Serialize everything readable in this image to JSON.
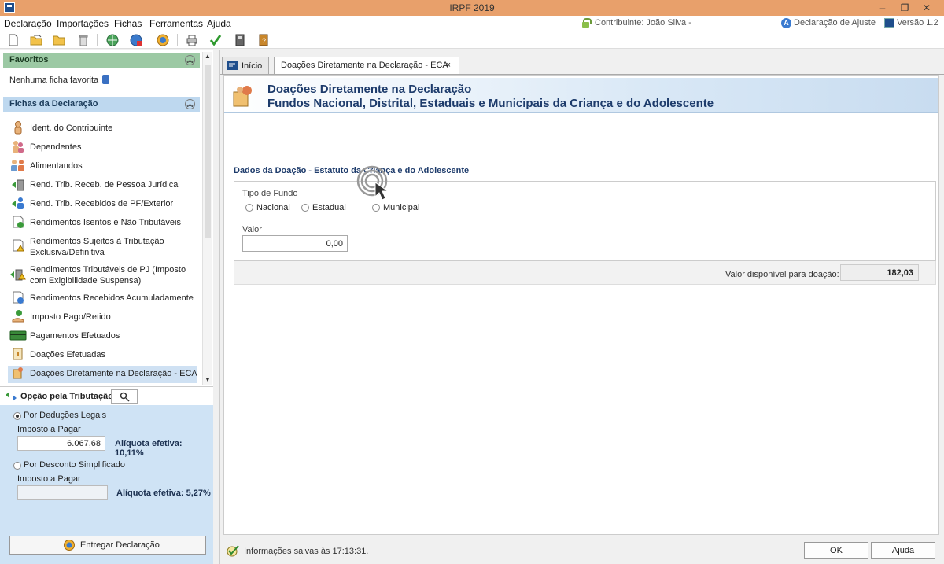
{
  "window": {
    "title": "IRPF 2019",
    "minimize": "–",
    "restore": "❐",
    "close": "✕"
  },
  "menu": {
    "items": [
      "Declaração",
      "Importações",
      "Fichas",
      "Ferramentas",
      "Ajuda"
    ],
    "contribuinte": "Contribuinte: João Silva -",
    "declaracao_tipo": "Declaração de Ajuste",
    "versao": "Versão 1.2"
  },
  "toolbar": {
    "buttons": [
      "new-file-icon",
      "open-folder-icon",
      "folder-icon",
      "trash-icon",
      "globe-receita-icon",
      "globe-transmit-icon",
      "globe-send-icon",
      "print-icon",
      "check-icon",
      "calculator-icon",
      "book-icon"
    ]
  },
  "sidebar": {
    "favoritos_title": "Favoritos",
    "favoritos_empty": "Nenhuma ficha favorita",
    "fichas_title": "Fichas da Declaração",
    "fichas": [
      {
        "label": "Ident. do Contribuinte",
        "icon": "person-icon"
      },
      {
        "label": "Dependentes",
        "icon": "dependents-icon"
      },
      {
        "label": "Alimentandos",
        "icon": "group-icon"
      },
      {
        "label": "Rend. Trib. Receb. de Pessoa Jurídica",
        "icon": "building-arrow-icon"
      },
      {
        "label": "Rend. Trib. Recebidos de PF/Exterior",
        "icon": "person-arrow-icon"
      },
      {
        "label": "Rendimentos Isentos e Não Tributáveis",
        "icon": "doc-check-icon"
      },
      {
        "label": "Rendimentos Sujeitos à Tributação Exclusiva/Definitiva",
        "icon": "doc-warning-icon"
      },
      {
        "label": "Rendimentos Tributáveis de PJ (Imposto com Exigibilidade Suspensa)",
        "icon": "building-warning-icon"
      },
      {
        "label": "Rendimentos Recebidos Acumuladamente",
        "icon": "doc-clock-icon"
      },
      {
        "label": "Imposto Pago/Retido",
        "icon": "money-hand-icon"
      },
      {
        "label": "Pagamentos Efetuados",
        "icon": "card-icon"
      },
      {
        "label": "Doações Efetuadas",
        "icon": "gift-doc-icon"
      },
      {
        "label": "Doações Diretamente na Declaração - ECA",
        "icon": "eca-icon"
      }
    ]
  },
  "tributacao": {
    "label": "Opção pela Tributação:",
    "deducoes_legais": "Por Deduções Legais",
    "imposto_a_pagar_1": "Imposto a Pagar",
    "valor_1": "6.067,68",
    "aliquota_1": "Alíquota efetiva: 10,11%",
    "desconto_simplificado": "Por Desconto Simplificado",
    "imposto_a_pagar_2": "Imposto a Pagar",
    "valor_2": "",
    "aliquota_2": "Alíquota efetiva: 5,27%",
    "entregar": "Entregar Declaração"
  },
  "tabs": {
    "inicio": "Início",
    "eca": "Doações Diretamente na Declaração - ECA",
    "close": "×"
  },
  "form": {
    "title1": "Doações Diretamente na Declaração",
    "title2": "Fundos Nacional, Distrital, Estaduais e Municipais da Criança e do Adolescente",
    "section_title": "Dados da Doação - Estatuto da Criança e do Adolescente",
    "tipo_fundo_label": "Tipo de Fundo",
    "options": [
      "Nacional",
      "Estadual",
      "Municipal"
    ],
    "valor_label": "Valor",
    "valor": "0,00",
    "disponivel_label": "Valor disponível para doação:",
    "disponivel_valor": "182,03"
  },
  "status": {
    "text": "Informações salvas às 17:13:31.",
    "ok": "OK",
    "ajuda": "Ajuda"
  },
  "colors": {
    "titlebar": "#e8a06b",
    "favoritos_header": "#9cc9a4",
    "fichas_header": "#bed8ef",
    "tributacao_panel": "#cfe3f5",
    "header_text": "#1d3b6b"
  }
}
